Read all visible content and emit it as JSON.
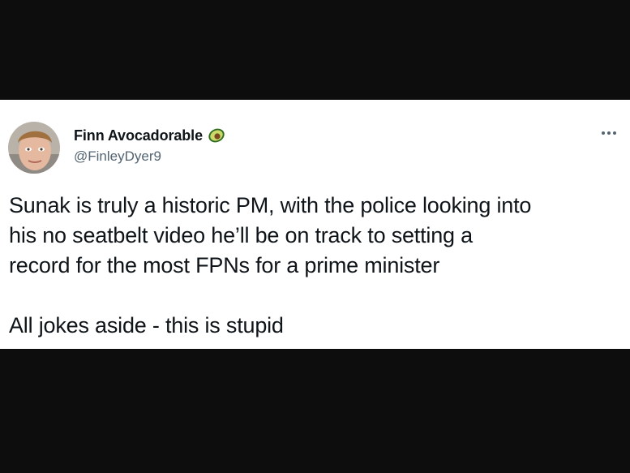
{
  "tweet": {
    "display_name": "Finn Avocadorable",
    "handle": "@FinleyDyer9",
    "avatar_icon": "user-avatar-photo",
    "name_emoji_icon": "avocado-icon",
    "more_icon": "more-options-icon",
    "text_lines": [
      "Sunak is truly a historic PM, with the police looking into",
      "his no seatbelt video he’ll be on track to setting a",
      "record for the most FPNs for a prime minister"
    ],
    "text_line_2": "All jokes aside - this is stupid"
  },
  "colors": {
    "letterbox": "#0d0d0d",
    "card_background": "#ffffff",
    "primary_text": "#0f1419",
    "secondary_text": "#536471"
  }
}
